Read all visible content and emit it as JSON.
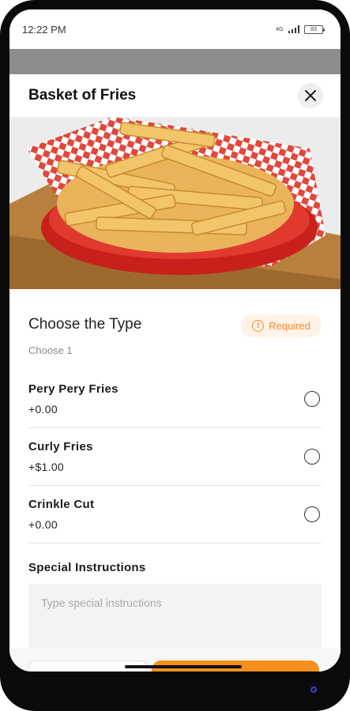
{
  "status_bar": {
    "time": "12:22 PM",
    "network": "4G",
    "battery": "83"
  },
  "sheet": {
    "title": "Basket of Fries",
    "close_icon": "close-icon",
    "hero_image": "basket-of-fries-photo"
  },
  "choose_type": {
    "title": "Choose the Type",
    "subtitle": "Choose 1",
    "badge": "Required",
    "badge_icon": "alert-icon",
    "accent": "#f08a2c",
    "options": [
      {
        "name": "Pery Pery Fries",
        "price": "+0.00",
        "selected": false
      },
      {
        "name": "Curly Fries",
        "price": "+$1.00",
        "selected": false
      },
      {
        "name": "Crinkle Cut",
        "price": "+0.00",
        "selected": false
      }
    ]
  },
  "special_instructions": {
    "label": "Special Instructions",
    "placeholder": "Type special instructions",
    "value": ""
  },
  "colors": {
    "primary_button": "#f5901e",
    "badge_bg": "#fff2e6"
  }
}
